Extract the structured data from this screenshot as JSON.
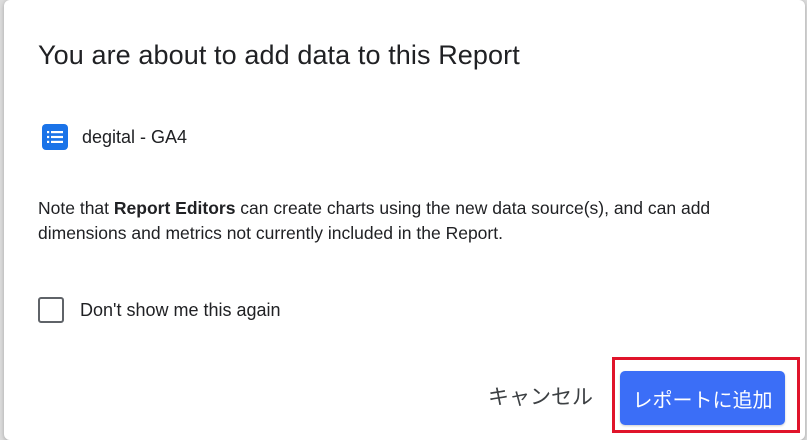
{
  "dialog": {
    "title": "You are about to add data to this Report",
    "data_source": {
      "icon": "list-icon",
      "name": "degital - GA4"
    },
    "note": {
      "prefix": "Note that ",
      "bold": "Report Editors",
      "suffix": " can create charts using the new data source(s), and can add dimensions and metrics not currently included in the Report."
    },
    "checkbox": {
      "label": "Don't show me this again",
      "checked": false
    },
    "buttons": {
      "cancel_label": "キャンセル",
      "add_label": "レポートに追加"
    }
  },
  "colors": {
    "primary": "#3b6ef7",
    "icon_blue": "#1a73e8",
    "highlight_red": "#e0142a"
  }
}
